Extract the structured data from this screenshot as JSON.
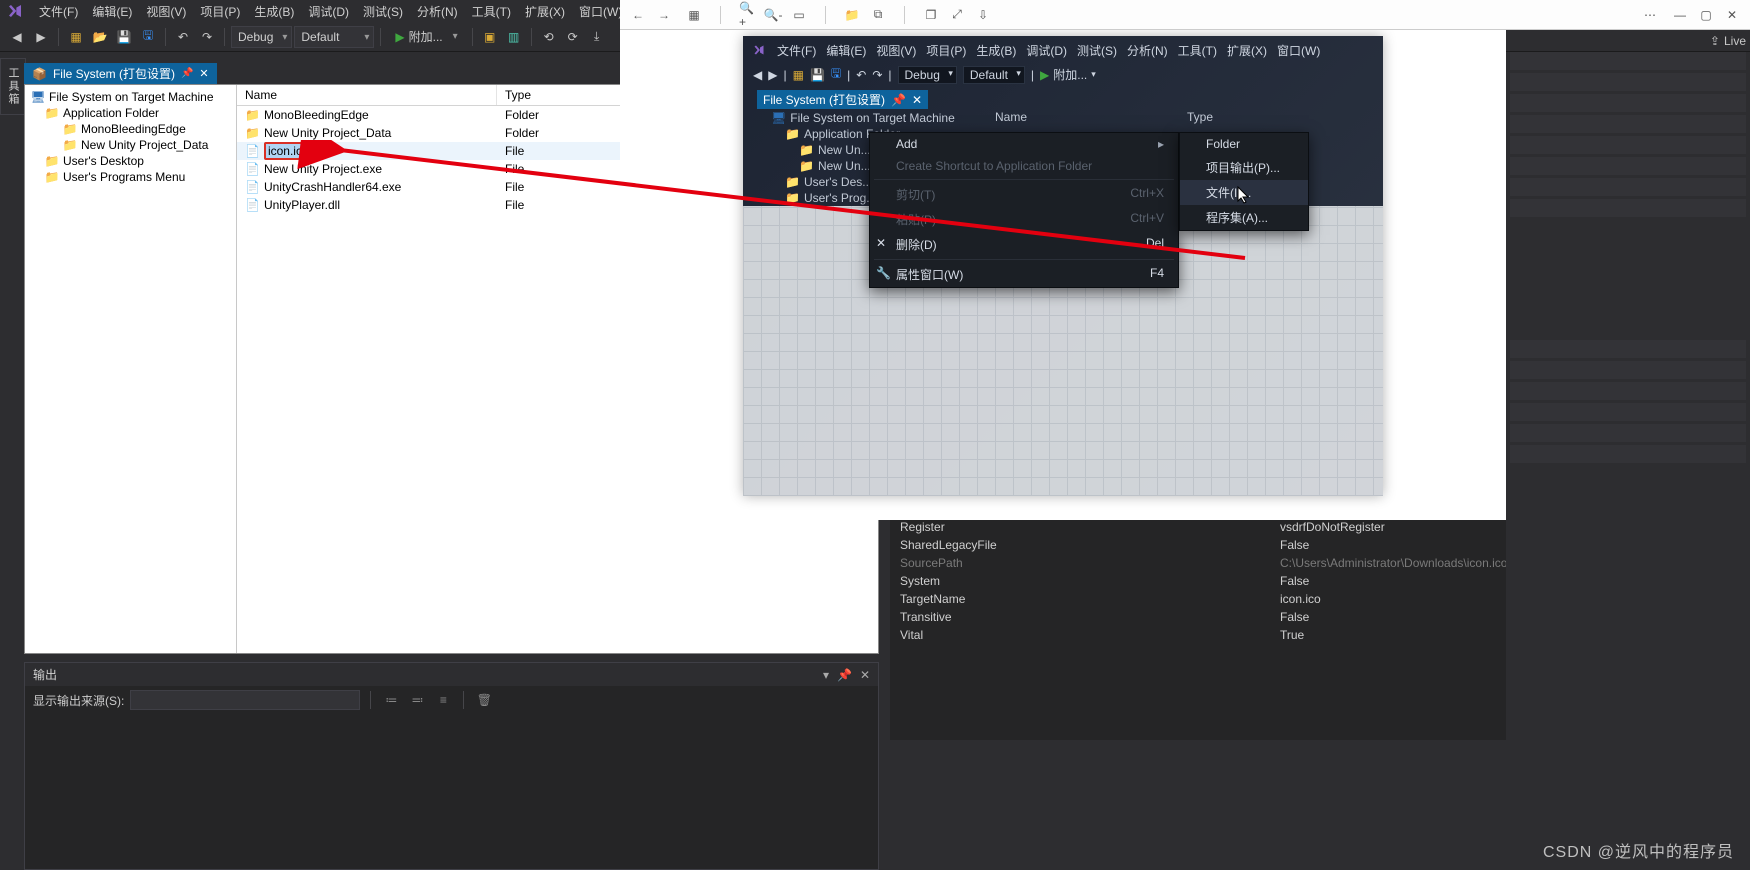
{
  "menubar": [
    "文件(F)",
    "编辑(E)",
    "视图(V)",
    "项目(P)",
    "生成(B)",
    "调试(D)",
    "测试(S)",
    "分析(N)",
    "工具(T)",
    "扩展(X)",
    "窗口(W)"
  ],
  "toolbar": {
    "config": "Debug",
    "platform": "Default",
    "start": "附加..."
  },
  "vtab": {
    "tool": "工具箱"
  },
  "doc_tab": {
    "title": "File System (打包设置)"
  },
  "live_share": "Live",
  "fs_tree": [
    {
      "label": "File System on Target Machine",
      "icon": "machine",
      "lvl": 0
    },
    {
      "label": "Application Folder",
      "icon": "folder",
      "lvl": 1
    },
    {
      "label": "MonoBleedingEdge",
      "icon": "folder",
      "lvl": 2
    },
    {
      "label": "New Unity Project_Data",
      "icon": "folder",
      "lvl": 2
    },
    {
      "label": "User's Desktop",
      "icon": "folder",
      "lvl": 1
    },
    {
      "label": "User's Programs Menu",
      "icon": "folder",
      "lvl": 1
    }
  ],
  "fs_headers": {
    "name": "Name",
    "type": "Type"
  },
  "fs_rows": [
    {
      "name": "MonoBleedingEdge",
      "type": "Folder",
      "icon": "folder"
    },
    {
      "name": "New Unity Project_Data",
      "type": "Folder",
      "icon": "folder"
    },
    {
      "name": "icon.ico",
      "type": "File",
      "icon": "file",
      "selected": true,
      "highlight": true
    },
    {
      "name": "New Unity Project.exe",
      "type": "File",
      "icon": "file"
    },
    {
      "name": "UnityCrashHandler64.exe",
      "type": "File",
      "icon": "file"
    },
    {
      "name": "UnityPlayer.dll",
      "type": "File",
      "icon": "file"
    }
  ],
  "output": {
    "title": "输出",
    "show_from": "显示输出来源(S):"
  },
  "props": [
    {
      "k": "Register",
      "v": "vsdrfDoNotRegister"
    },
    {
      "k": "SharedLegacyFile",
      "v": "False"
    },
    {
      "k": "SourcePath",
      "v": "C:\\Users\\Administrator\\Downloads\\icon.ico",
      "dim": true
    },
    {
      "k": "System",
      "v": "False"
    },
    {
      "k": "TargetName",
      "v": "icon.ico"
    },
    {
      "k": "Transitive",
      "v": "False"
    },
    {
      "k": "Vital",
      "v": "True"
    }
  ],
  "inner": {
    "menubar": [
      "文件(F)",
      "编辑(E)",
      "视图(V)",
      "项目(P)",
      "生成(B)",
      "调试(D)",
      "测试(S)",
      "分析(N)",
      "工具(T)",
      "扩展(X)",
      "窗口(W)"
    ],
    "config": "Debug",
    "platform": "Default",
    "start": "附加...",
    "doc_tab": "File System (打包设置)",
    "tree": [
      {
        "label": "File System on Target Machine",
        "lvl": 0,
        "icon": "machine"
      },
      {
        "label": "Application Folder",
        "lvl": 1,
        "icon": "folder"
      },
      {
        "label": "New Un...",
        "lvl": 2,
        "icon": "folder"
      },
      {
        "label": "New Un...",
        "lvl": 2,
        "icon": "folder"
      },
      {
        "label": "User's Des...",
        "lvl": 1,
        "icon": "folder"
      },
      {
        "label": "User's Prog...",
        "lvl": 1,
        "icon": "folder"
      }
    ],
    "list_hdr": {
      "name": "Name",
      "type": "Type"
    },
    "ctx1": [
      {
        "label": "Add",
        "arrow": true
      },
      {
        "label": "Create Shortcut to Application Folder",
        "disabled": true
      },
      {
        "sep": true
      },
      {
        "label": "剪切(T)",
        "short": "Ctrl+X",
        "disabled": true
      },
      {
        "label": "粘贴(P)",
        "short": "Ctrl+V",
        "disabled": true
      },
      {
        "label": "删除(D)",
        "short": "Del",
        "icon": "✕"
      },
      {
        "sep": true
      },
      {
        "label": "属性窗口(W)",
        "short": "F4",
        "icon": "🔧"
      }
    ],
    "ctx2": [
      {
        "label": "Folder"
      },
      {
        "label": "项目输出(P)..."
      },
      {
        "label": "文件(I)...",
        "hl": true
      },
      {
        "label": "程序集(A)..."
      }
    ]
  },
  "watermark": "CSDN @逆风中的程序员"
}
